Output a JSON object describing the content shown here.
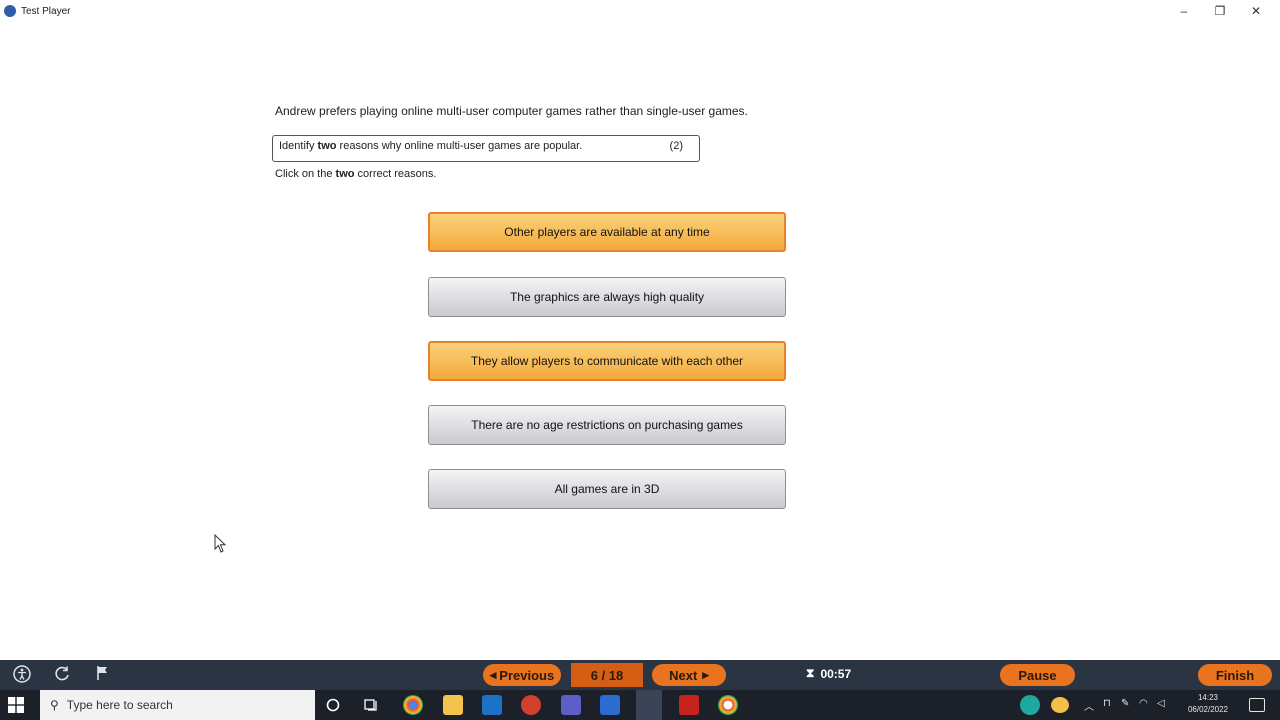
{
  "window": {
    "title": "Test Player",
    "controls": {
      "minimize": "–",
      "maximize": "❐",
      "close": "✕"
    }
  },
  "question": {
    "intro": "Andrew prefers playing online multi-user computer games rather than single-user games.",
    "prompt_before": "Identify ",
    "prompt_bold": "two",
    "prompt_after": " reasons why online multi-user games are popular.",
    "marks": "(2)",
    "instruction_before": "Click on the ",
    "instruction_bold": "two",
    "instruction_after": " correct reasons."
  },
  "answers": [
    {
      "label": "Other players are available at any time",
      "selected": true
    },
    {
      "label": "The graphics are always high quality",
      "selected": false
    },
    {
      "label": "They allow players to communicate with each other",
      "selected": true
    },
    {
      "label": "There are no age restrictions on purchasing games",
      "selected": false
    },
    {
      "label": "All games are in 3D",
      "selected": false
    }
  ],
  "player_bar": {
    "previous_label": "Previous",
    "counter": "6 / 18",
    "next_label": "Next",
    "timer": "00:57",
    "pause_label": "Pause",
    "finish_label": "Finish",
    "icons": [
      "accessibility-icon",
      "refresh-icon",
      "flag-icon"
    ]
  },
  "taskbar": {
    "search_placeholder": "Type here to search",
    "clock_time": "14:23",
    "clock_date": "06/02/2022"
  },
  "colors": {
    "selected_fill": "#f3a93b",
    "selected_border": "#e8822a",
    "unselected_fill": "#c9c9cf",
    "player_bar_bg": "#2b3442",
    "nav_button": "#e9731f"
  }
}
